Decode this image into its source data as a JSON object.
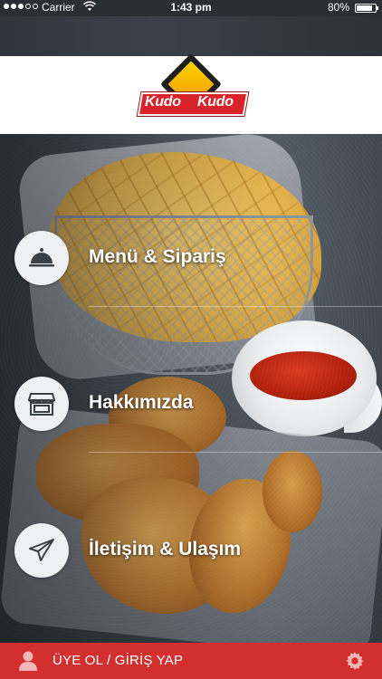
{
  "status_bar": {
    "carrier": "Carrier",
    "time": "1:43 pm",
    "battery": "80%",
    "signal_icon": "signal-dots-icon",
    "wifi_icon": "wifi-icon",
    "battery_icon": "battery-icon"
  },
  "header": {
    "logo_text": "Kudo Kudo"
  },
  "menu": [
    {
      "label": "Menü & Sipariş",
      "icon": "cloche-icon"
    },
    {
      "label": "Hakkımızda",
      "icon": "store-icon"
    },
    {
      "label": "İletişim & Ulaşım",
      "icon": "paper-plane-icon"
    }
  ],
  "bottom_bar": {
    "login_label": "ÜYE OL / GİRİŞ YAP",
    "user_icon": "user-icon",
    "settings_icon": "gear-icon",
    "color": "#d32f2f"
  },
  "colors": {
    "accent_red": "#d32f2f",
    "logo_red": "#d8232a",
    "logo_yellow": "#f5b400"
  }
}
